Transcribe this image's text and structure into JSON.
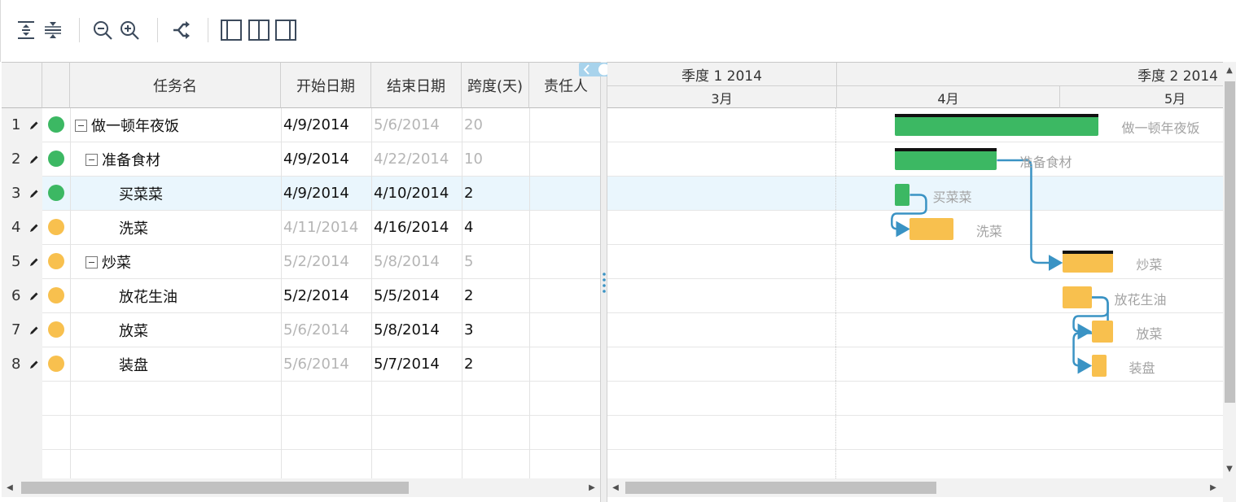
{
  "toolbar": {
    "buttons": [
      {
        "name": "expand-all-icon"
      },
      {
        "name": "collapse-all-icon"
      },
      {
        "name": "zoom-out-icon"
      },
      {
        "name": "zoom-in-icon"
      },
      {
        "name": "critical-path-icon"
      },
      {
        "name": "show-grid-only-icon"
      },
      {
        "name": "show-both-icon"
      },
      {
        "name": "show-chart-only-icon"
      }
    ]
  },
  "grid": {
    "columns": {
      "name": "任务名",
      "start": "开始日期",
      "end": "结束日期",
      "duration": "跨度(天)",
      "owner": "责任人"
    },
    "rows": [
      {
        "num": "1",
        "status": "#3cb863",
        "toggle": true,
        "name": "做一顿年夜饭",
        "start": "4/9/2014",
        "end": "5/6/2014",
        "duration": "20",
        "start_muted": false,
        "end_muted": true,
        "duration_muted": true,
        "level": 0
      },
      {
        "num": "2",
        "status": "#3cb863",
        "toggle": true,
        "name": "准备食材",
        "start": "4/9/2014",
        "end": "4/22/2014",
        "duration": "10",
        "start_muted": false,
        "end_muted": true,
        "duration_muted": true,
        "level": 1
      },
      {
        "num": "3",
        "status": "#3cb863",
        "toggle": false,
        "name": "买菜菜",
        "start": "4/9/2014",
        "end": "4/10/2014",
        "duration": "2",
        "start_muted": false,
        "end_muted": false,
        "duration_muted": false,
        "level": 2
      },
      {
        "num": "4",
        "status": "#f8c04e",
        "toggle": false,
        "name": "洗菜",
        "start": "4/11/2014",
        "end": "4/16/2014",
        "duration": "4",
        "start_muted": true,
        "end_muted": false,
        "duration_muted": false,
        "level": 2
      },
      {
        "num": "5",
        "status": "#f8c04e",
        "toggle": true,
        "name": "炒菜",
        "start": "5/2/2014",
        "end": "5/8/2014",
        "duration": "5",
        "start_muted": true,
        "end_muted": true,
        "duration_muted": true,
        "level": 1
      },
      {
        "num": "6",
        "status": "#f8c04e",
        "toggle": false,
        "name": "放花生油",
        "start": "5/2/2014",
        "end": "5/5/2014",
        "duration": "2",
        "start_muted": false,
        "end_muted": false,
        "duration_muted": false,
        "level": 2
      },
      {
        "num": "7",
        "status": "#f8c04e",
        "toggle": false,
        "name": "放菜",
        "start": "5/6/2014",
        "end": "5/8/2014",
        "duration": "3",
        "start_muted": true,
        "end_muted": false,
        "duration_muted": false,
        "level": 2
      },
      {
        "num": "8",
        "status": "#f8c04e",
        "toggle": false,
        "name": "装盘",
        "start": "5/6/2014",
        "end": "5/7/2014",
        "duration": "2",
        "start_muted": true,
        "end_muted": false,
        "duration_muted": false,
        "level": 2
      }
    ]
  },
  "gantt": {
    "quarters": [
      "季度 1 2014",
      "季度 2 2014"
    ],
    "months": [
      "3月",
      "4月",
      "5月"
    ],
    "bar_labels": [
      "做一顿年夜饭",
      "准备食材",
      "买菜菜",
      "洗菜",
      "炒菜",
      "放花生油",
      "放菜",
      "装盘"
    ],
    "colors": {
      "done": "#3cb863",
      "pending": "#f8c04e",
      "link": "#3a93c4",
      "selected_row": "#eaf6fd"
    }
  }
}
